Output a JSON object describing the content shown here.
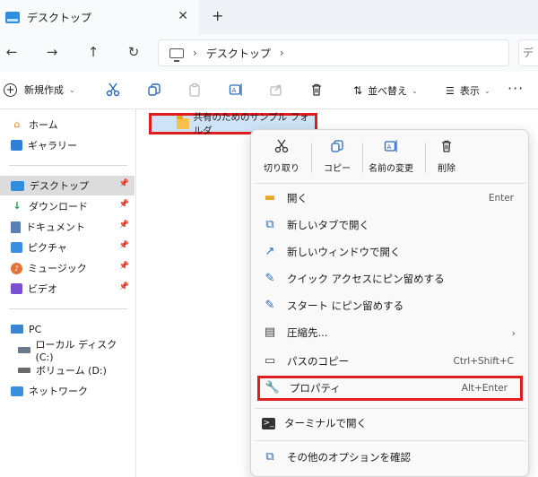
{
  "tab": {
    "title": "デスクトップ",
    "close": "✕",
    "new": "+"
  },
  "nav": {
    "back": "←",
    "forward": "→",
    "up": "↑",
    "refresh": "↻"
  },
  "address": {
    "sep1": "›",
    "crumb": "デスクトップ",
    "sep2": "›"
  },
  "search_stub": "デ",
  "toolbar": {
    "new_label": "新規作成",
    "new_plus": "+",
    "caret": "⌄",
    "sort_label": "並べ替え",
    "view_label": "表示",
    "more": "···"
  },
  "sidebar": {
    "items": [
      {
        "label": "ホーム",
        "icon": "home-icon"
      },
      {
        "label": "ギャラリー",
        "icon": "gallery-icon"
      },
      {
        "label": "デスクトップ",
        "icon": "desktop-icon",
        "selected": true,
        "pinned": true
      },
      {
        "label": "ダウンロード",
        "icon": "download-icon",
        "pinned": true
      },
      {
        "label": "ドキュメント",
        "icon": "document-icon",
        "pinned": true
      },
      {
        "label": "ピクチャ",
        "icon": "picture-icon",
        "pinned": true
      },
      {
        "label": "ミュージック",
        "icon": "music-icon",
        "pinned": true
      },
      {
        "label": "ビデオ",
        "icon": "video-icon",
        "pinned": true
      },
      {
        "label": "PC",
        "icon": "pc-icon"
      },
      {
        "label": "ローカル ディスク (C:)",
        "icon": "drive-icon"
      },
      {
        "label": "ボリューム (D:)",
        "icon": "drive-icon"
      },
      {
        "label": "ネットワーク",
        "icon": "network-icon"
      }
    ]
  },
  "content": {
    "selected_folder": "共有のためのサンプル フォルダ"
  },
  "context_menu": {
    "quick_actions": [
      {
        "label": "切り取り",
        "icon": "cut-icon"
      },
      {
        "label": "コピー",
        "icon": "copy-icon"
      },
      {
        "label": "名前の変更",
        "icon": "rename-icon"
      },
      {
        "label": "削除",
        "icon": "delete-icon"
      }
    ],
    "items": [
      {
        "label": "開く",
        "shortcut": "Enter",
        "icon": "open-folder-icon"
      },
      {
        "label": "新しいタブで開く",
        "shortcut": "",
        "icon": "new-tab-icon"
      },
      {
        "label": "新しいウィンドウで開く",
        "shortcut": "",
        "icon": "new-window-icon"
      },
      {
        "label": "クイック アクセスにピン留めする",
        "shortcut": "",
        "icon": "pin-icon"
      },
      {
        "label": "スタート にピン留めする",
        "shortcut": "",
        "icon": "pin-icon"
      },
      {
        "label": "圧縮先...",
        "shortcut": "",
        "icon": "zip-icon",
        "submenu": true
      },
      {
        "label": "パスのコピー",
        "shortcut": "Ctrl+Shift+C",
        "icon": "copy-path-icon"
      },
      {
        "label": "プロパティ",
        "shortcut": "Alt+Enter",
        "icon": "wrench-icon",
        "highlighted": true
      },
      {
        "label": "ターミナルで開く",
        "shortcut": "",
        "icon": "terminal-icon"
      },
      {
        "label": "その他のオプションを確認",
        "shortcut": "",
        "icon": "more-options-icon"
      }
    ],
    "submenu_arrow": "›"
  },
  "colors": {
    "highlight_border": "#e01c1c",
    "selection_bg": "#cfe3f6",
    "accent": "#2a6ab8"
  }
}
